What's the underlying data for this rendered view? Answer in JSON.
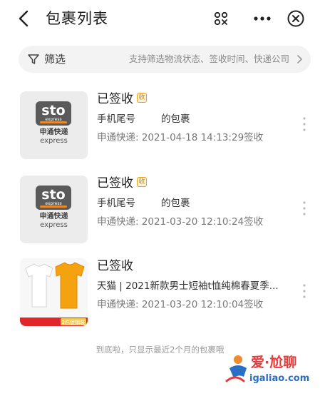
{
  "header": {
    "title": "包裹列表",
    "icons": {
      "back": "chevron-left-icon",
      "scan": "scan-icon",
      "more": "more-dots-icon",
      "close": "close-circle-icon"
    }
  },
  "filter": {
    "label": "筛选",
    "hint": "支持筛选物流状态、签收时间、快递公司"
  },
  "packages": [
    {
      "status": "已签收",
      "badge": "收",
      "desc_prefix": "手机尾号",
      "desc_suffix": "的包裹",
      "courier_time": "申通快递: 2021-04-18 14:13:29签收",
      "logo": {
        "text": "sto",
        "sub": "express",
        "cn": "申通快递",
        "en": "express"
      }
    },
    {
      "status": "已签收",
      "badge": "收",
      "desc_prefix": "手机尾号",
      "desc_suffix": "的包裹",
      "courier_time": "申通快递: 2021-03-20 12:10:24签收",
      "logo": {
        "text": "sto",
        "sub": "express",
        "cn": "申通快递",
        "en": "express"
      }
    },
    {
      "status": "已签收",
      "desc": "天猫 | 2021新款男士短袖t恤纯棉春夏季...",
      "courier_time": "申通快递: 2021-03-20 12:10:04签收",
      "promo": "2件促销装"
    }
  ],
  "footer_note": "到底啦，只显示最近2个月的包裹哦",
  "watermark": {
    "cn": "爱·尬聊",
    "url": "igaliao.com"
  },
  "colors": {
    "badge": "#e3a21a",
    "promo": "#e0262b",
    "logo_stripe": "#e98a2b",
    "filter_bg": "#f3f3f3"
  }
}
